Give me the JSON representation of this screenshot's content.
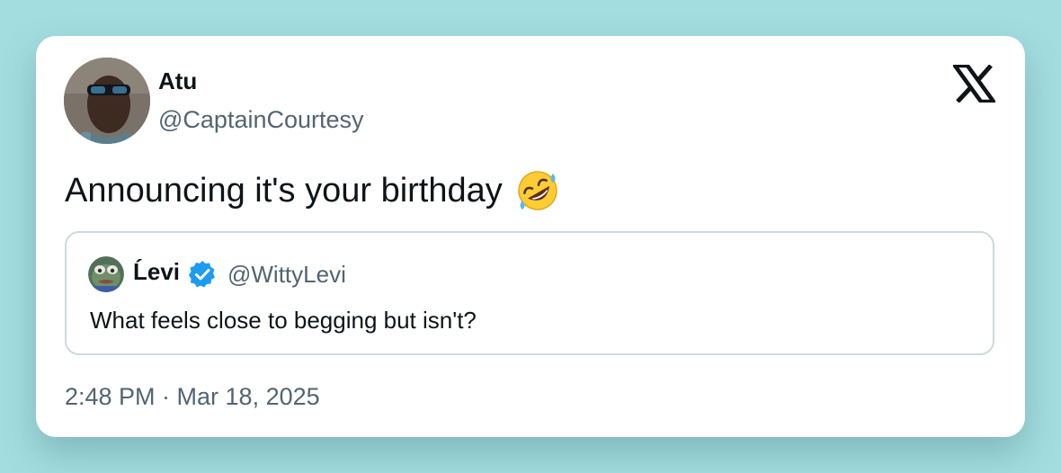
{
  "tweet": {
    "author": {
      "display_name": "Atu",
      "handle": "@CaptainCourtesy",
      "avatar": "avatar-photo"
    },
    "logo": "x-logo-icon",
    "text": "Announcing it's your birthday",
    "emoji": "rolling-on-floor-laughing-emoji",
    "timestamp": "2:48 PM · Mar 18, 2025"
  },
  "quote": {
    "display_name": "Ĺevi",
    "handle": "@WittyLevi",
    "verified": true,
    "avatar": "pepe-frog-avatar",
    "text": "What feels close to begging but isn't?"
  },
  "colors": {
    "background": "#a3dde0",
    "card": "#ffffff",
    "primary_text": "#0f1419",
    "secondary_text": "#536471",
    "border": "#cfd9de",
    "verified_blue": "#1d9bf0"
  }
}
